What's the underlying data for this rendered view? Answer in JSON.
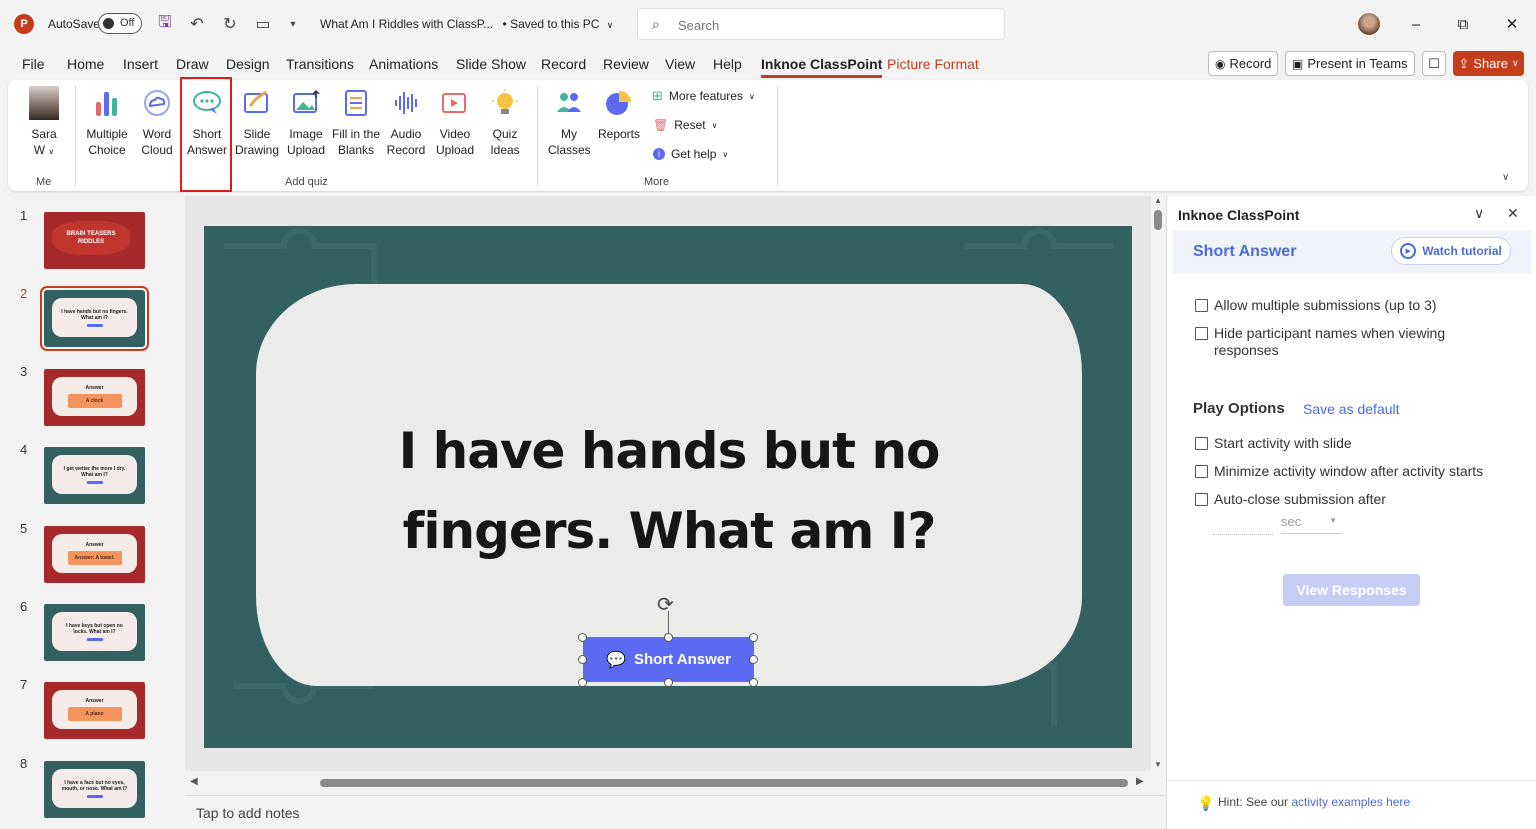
{
  "titlebar": {
    "app_icon": "P",
    "autosave_label": "AutoSave",
    "autosave_state": "Off",
    "doc_title": "What Am I Riddles with ClassP...",
    "saved_status": "• Saved to this PC",
    "search_placeholder": "Search"
  },
  "menu": {
    "tabs": [
      "File",
      "Home",
      "Insert",
      "Draw",
      "Design",
      "Transitions",
      "Animations",
      "Slide Show",
      "Record",
      "Review",
      "View",
      "Help",
      "Inknoe ClassPoint",
      "Picture Format"
    ],
    "active_tab": "Inknoe ClassPoint",
    "record_label": "Record",
    "present_label": "Present in Teams",
    "share_label": "Share"
  },
  "ribbon": {
    "me": {
      "name_line1": "Sara",
      "name_line2": "W",
      "group": "Me"
    },
    "quiz_buttons": [
      {
        "line1": "Multiple",
        "line2": "Choice"
      },
      {
        "line1": "Word",
        "line2": "Cloud"
      },
      {
        "line1": "Short",
        "line2": "Answer"
      },
      {
        "line1": "Slide",
        "line2": "Drawing"
      },
      {
        "line1": "Image",
        "line2": "Upload"
      },
      {
        "line1": "Fill in the",
        "line2": "Blanks"
      },
      {
        "line1": "Audio",
        "line2": "Record"
      },
      {
        "line1": "Video",
        "line2": "Upload"
      },
      {
        "line1": "Quiz",
        "line2": "Ideas"
      }
    ],
    "add_quiz_group": "Add quiz",
    "my_classes": {
      "line1": "My",
      "line2": "Classes"
    },
    "reports": "Reports",
    "more_features": "More features",
    "reset": "Reset",
    "get_help": "Get help",
    "more_group": "More"
  },
  "thumbnails": [
    {
      "num": "1",
      "title": "BRAIN TEASERS RIDDLES"
    },
    {
      "num": "2",
      "title": "I have hands but no fingers. What am I?"
    },
    {
      "num": "3",
      "title": "Answer",
      "answer": "A clock"
    },
    {
      "num": "4",
      "title": "I get wetter the more I dry. What am I?"
    },
    {
      "num": "5",
      "title": "Answer",
      "answer": "Answer: A towel."
    },
    {
      "num": "6",
      "title": "I have keys but open no locks. What am I?"
    },
    {
      "num": "7",
      "title": "Answer",
      "answer": "A piano"
    },
    {
      "num": "8",
      "title": "I have a face but no eyes, mouth, or nose. What am I?"
    }
  ],
  "slide": {
    "line1": "I have hands but no",
    "line2": "fingers. What am I?",
    "button_label": "Short Answer"
  },
  "notes_placeholder": "Tap to add notes",
  "pane": {
    "title": "Inknoe ClassPoint",
    "heading": "Short Answer",
    "watch_tutorial": "Watch tutorial",
    "opt_multiple": "Allow multiple submissions (up to 3)",
    "opt_hide_line1": "Hide participant names when viewing",
    "opt_hide_line2": "responses",
    "play_options": "Play Options",
    "save_default": "Save as default",
    "opt_start": "Start activity with slide",
    "opt_minimize": "Minimize activity window after activity starts",
    "opt_autoclose": "Auto-close submission after",
    "sec_unit": "sec",
    "view_responses": "View Responses",
    "hint_prefix": "Hint: See our ",
    "hint_link": "activity examples here"
  }
}
